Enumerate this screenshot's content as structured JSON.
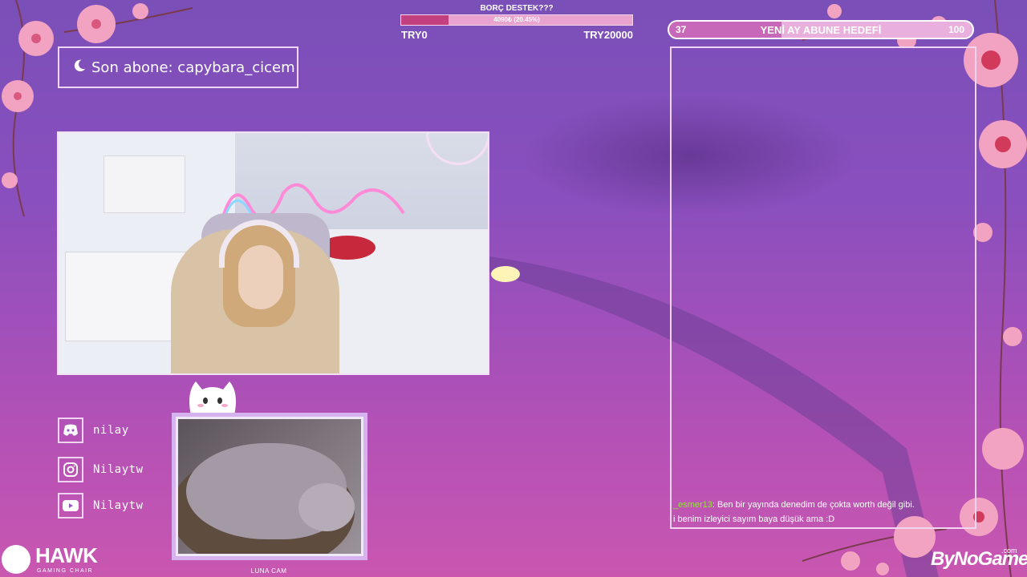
{
  "donation_goal": {
    "title": "BORÇ DESTEK???",
    "amount_text": "4090₺ (20.45%)",
    "progress_percent": 20.45,
    "min_label": "TRY0",
    "max_label": "TRY20000"
  },
  "subscriber_goal": {
    "current": "37",
    "title": "YENİ AY ABUNE HEDEFİ",
    "target": "100",
    "progress_fraction": 0.37
  },
  "last_subscriber": {
    "text": "Son abone: capybara_cicem"
  },
  "chat": {
    "messages": [
      {
        "user": "_esmer13",
        "sep": ": ",
        "text": "Ben bir yayında denedim de çokta worth değil gibi."
      },
      {
        "user": "",
        "sep": "",
        "text": "i benim izleyici sayım baya düşük ama :D"
      }
    ]
  },
  "socials": [
    {
      "icon": "discord-icon",
      "label": "nilay"
    },
    {
      "icon": "instagram-icon",
      "label": "Nilaytw"
    },
    {
      "icon": "youtube-icon",
      "label": "Nilaytw"
    }
  ],
  "cat_cam": {
    "label": "LUNA CAM"
  },
  "sponsors": {
    "hawk_name": "HAWK",
    "hawk_tagline": "GAMING CHAIR",
    "nogame_name": "ByNoGame",
    "nogame_suffix": ".com"
  },
  "colors": {
    "bg_top": "#7a4fb8",
    "bg_bottom": "#c957b0",
    "accent_pink": "#c2407e",
    "chat_username": "#8bea2f",
    "frame": "#f1d6f1"
  }
}
